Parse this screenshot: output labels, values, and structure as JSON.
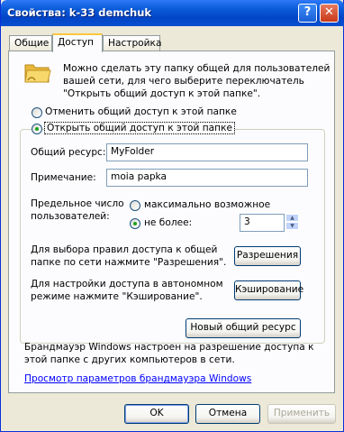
{
  "window": {
    "title": "Свойства: k-33 demchuk",
    "help_btn": "?",
    "close_btn": "✕"
  },
  "tabs": [
    {
      "label": "Общие"
    },
    {
      "label": "Доступ"
    },
    {
      "label": "Настройка"
    }
  ],
  "sharing": {
    "intro": [
      "Можно сделать эту папку общей для пользователей",
      "вашей сети, для чего выберите переключатель",
      "\"Открыть общий доступ к этой папке\"."
    ],
    "radio_disable": "Отменить общий доступ к этой папке",
    "radio_enable": "Открыть общий доступ к этой папке",
    "share_name_label": "Общий ресурс:",
    "share_name_value": "MyFolder",
    "comment_label": "Примечание:",
    "comment_value": "moia papka",
    "user_limit_label": [
      "Предельное число",
      "пользователей:"
    ],
    "radio_max": "максимально возможное",
    "radio_no_more": "не более:",
    "no_more_value": "3",
    "permissions_text": [
      "Для выбора правил доступа к общей",
      "папке по сети нажмите \"Разрешения\"."
    ],
    "permissions_btn": "Разрешения",
    "caching_text": [
      "Для настройки доступа в автономном",
      "режиме нажмите \"Кэширование\"."
    ],
    "caching_btn": "Кэширование",
    "new_share_btn": "Новый общий ресурс",
    "firewall_text": [
      "Брандмауэр Windows настроен на разрешение доступа к",
      "этой папке с других компьютеров в сети."
    ],
    "firewall_link": "Просмотр параметров брандмауэра Windows"
  },
  "footer": {
    "ok": "OK",
    "cancel": "Отмена",
    "apply": "Применить"
  }
}
